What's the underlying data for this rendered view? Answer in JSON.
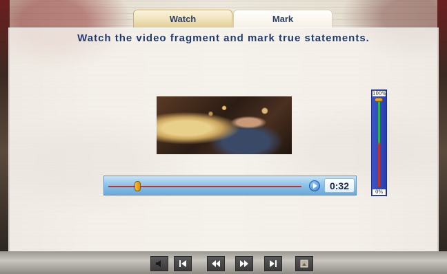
{
  "tabs": [
    {
      "label": "Watch",
      "active": true
    },
    {
      "label": "Mark",
      "active": false
    }
  ],
  "instruction": "Watch the video fragment and mark true statements.",
  "player": {
    "progress_fraction": 0.15,
    "time": "0:32",
    "play_icon": "play-icon"
  },
  "volume": {
    "max_label": "100%",
    "min_label": "0%",
    "level_fraction": 1.0
  },
  "nav": {
    "icons": [
      "speaker-icon",
      "first-icon",
      "rewind-icon",
      "fast-forward-icon",
      "last-icon",
      "help-icon"
    ]
  },
  "colors": {
    "accent": "#1f3a6e",
    "track": "#c0322d",
    "volume_bg": "#3b55c8"
  }
}
